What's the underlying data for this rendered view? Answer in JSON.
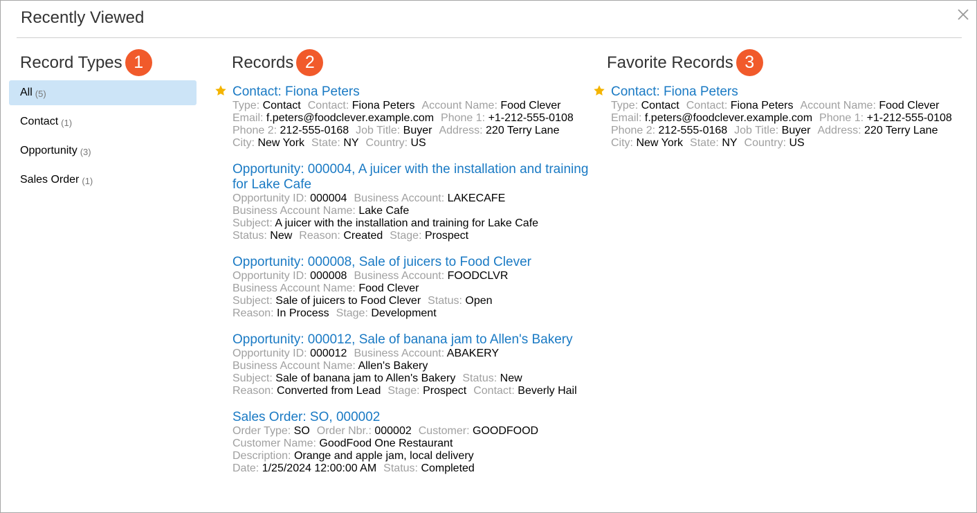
{
  "dialog": {
    "title": "Recently Viewed",
    "close_icon": "close-icon"
  },
  "colors": {
    "badge": "#f15a2b",
    "link": "#1a7ac4",
    "star": "#f4b400",
    "selected_bg": "#cce4f7",
    "label": "#a0a0a0"
  },
  "columns": {
    "types": {
      "title": "Record Types",
      "badge": "1"
    },
    "records": {
      "title": "Records",
      "badge": "2"
    },
    "favorites": {
      "title": "Favorite Records",
      "badge": "3"
    }
  },
  "record_types": [
    {
      "label": "All",
      "count": "(5)",
      "selected": true
    },
    {
      "label": "Contact",
      "count": "(1)",
      "selected": false
    },
    {
      "label": "Opportunity",
      "count": "(3)",
      "selected": false
    },
    {
      "label": "Sales Order",
      "count": "(1)",
      "selected": false
    }
  ],
  "records": [
    {
      "title": "Contact: Fiona Peters",
      "starred": true,
      "lines": [
        [
          [
            "Type:",
            "Contact"
          ],
          [
            "Contact:",
            "Fiona Peters"
          ],
          [
            "Account Name:",
            "Food Clever"
          ]
        ],
        [
          [
            "Email:",
            "f.peters@foodclever.example.com"
          ],
          [
            "Phone 1:",
            "+1-212-555-0108"
          ]
        ],
        [
          [
            "Phone 2:",
            "212-555-0168"
          ],
          [
            "Job Title:",
            "Buyer"
          ],
          [
            "Address:",
            "220 Terry Lane"
          ]
        ],
        [
          [
            "City:",
            "New York"
          ],
          [
            "State:",
            "NY"
          ],
          [
            "Country:",
            "US"
          ]
        ]
      ]
    },
    {
      "title": "Opportunity: 000004, A juicer with the installation and training for Lake Cafe",
      "starred": false,
      "lines": [
        [
          [
            "Opportunity ID:",
            "000004"
          ],
          [
            "Business Account:",
            "LAKECAFE"
          ]
        ],
        [
          [
            "Business Account Name:",
            "Lake Cafe"
          ]
        ],
        [
          [
            "Subject:",
            "A juicer with the installation and training for Lake Cafe"
          ]
        ],
        [
          [
            "Status:",
            "New"
          ],
          [
            "Reason:",
            "Created"
          ],
          [
            "Stage:",
            "Prospect"
          ]
        ]
      ]
    },
    {
      "title": "Opportunity: 000008, Sale of juicers to Food Clever",
      "starred": false,
      "lines": [
        [
          [
            "Opportunity ID:",
            "000008"
          ],
          [
            "Business Account:",
            "FOODCLVR"
          ]
        ],
        [
          [
            "Business Account Name:",
            "Food Clever"
          ]
        ],
        [
          [
            "Subject:",
            "Sale of juicers to Food Clever"
          ],
          [
            "Status:",
            "Open"
          ]
        ],
        [
          [
            "Reason:",
            "In Process"
          ],
          [
            "Stage:",
            "Development"
          ]
        ]
      ]
    },
    {
      "title": "Opportunity: 000012, Sale of banana jam to Allen's Bakery",
      "starred": false,
      "lines": [
        [
          [
            "Opportunity ID:",
            "000012"
          ],
          [
            "Business Account:",
            "ABAKERY"
          ]
        ],
        [
          [
            "Business Account Name:",
            "Allen's Bakery"
          ]
        ],
        [
          [
            "Subject:",
            "Sale of banana jam to Allen's Bakery"
          ],
          [
            "Status:",
            "New"
          ]
        ],
        [
          [
            "Reason:",
            "Converted from Lead"
          ],
          [
            "Stage:",
            "Prospect"
          ],
          [
            "Contact:",
            "Beverly Hail"
          ]
        ]
      ]
    },
    {
      "title": "Sales Order: SO, 000002",
      "starred": false,
      "lines": [
        [
          [
            "Order Type:",
            "SO"
          ],
          [
            "Order Nbr.:",
            "000002"
          ],
          [
            "Customer:",
            "GOODFOOD"
          ]
        ],
        [
          [
            "Customer Name:",
            "GoodFood One Restaurant"
          ]
        ],
        [
          [
            "Description:",
            "Orange and apple jam, local delivery"
          ]
        ],
        [
          [
            "Date:",
            "1/25/2024 12:00:00 AM"
          ],
          [
            "Status:",
            "Completed"
          ]
        ]
      ]
    }
  ],
  "favorites": [
    {
      "title": "Contact: Fiona Peters",
      "starred": true,
      "lines": [
        [
          [
            "Type:",
            "Contact"
          ],
          [
            "Contact:",
            "Fiona Peters"
          ],
          [
            "Account Name:",
            "Food Clever"
          ]
        ],
        [
          [
            "Email:",
            "f.peters@foodclever.example.com"
          ],
          [
            "Phone 1:",
            "+1-212-555-0108"
          ]
        ],
        [
          [
            "Phone 2:",
            "212-555-0168"
          ],
          [
            "Job Title:",
            "Buyer"
          ],
          [
            "Address:",
            "220 Terry Lane"
          ]
        ],
        [
          [
            "City:",
            "New York"
          ],
          [
            "State:",
            "NY"
          ],
          [
            "Country:",
            "US"
          ]
        ]
      ]
    }
  ]
}
